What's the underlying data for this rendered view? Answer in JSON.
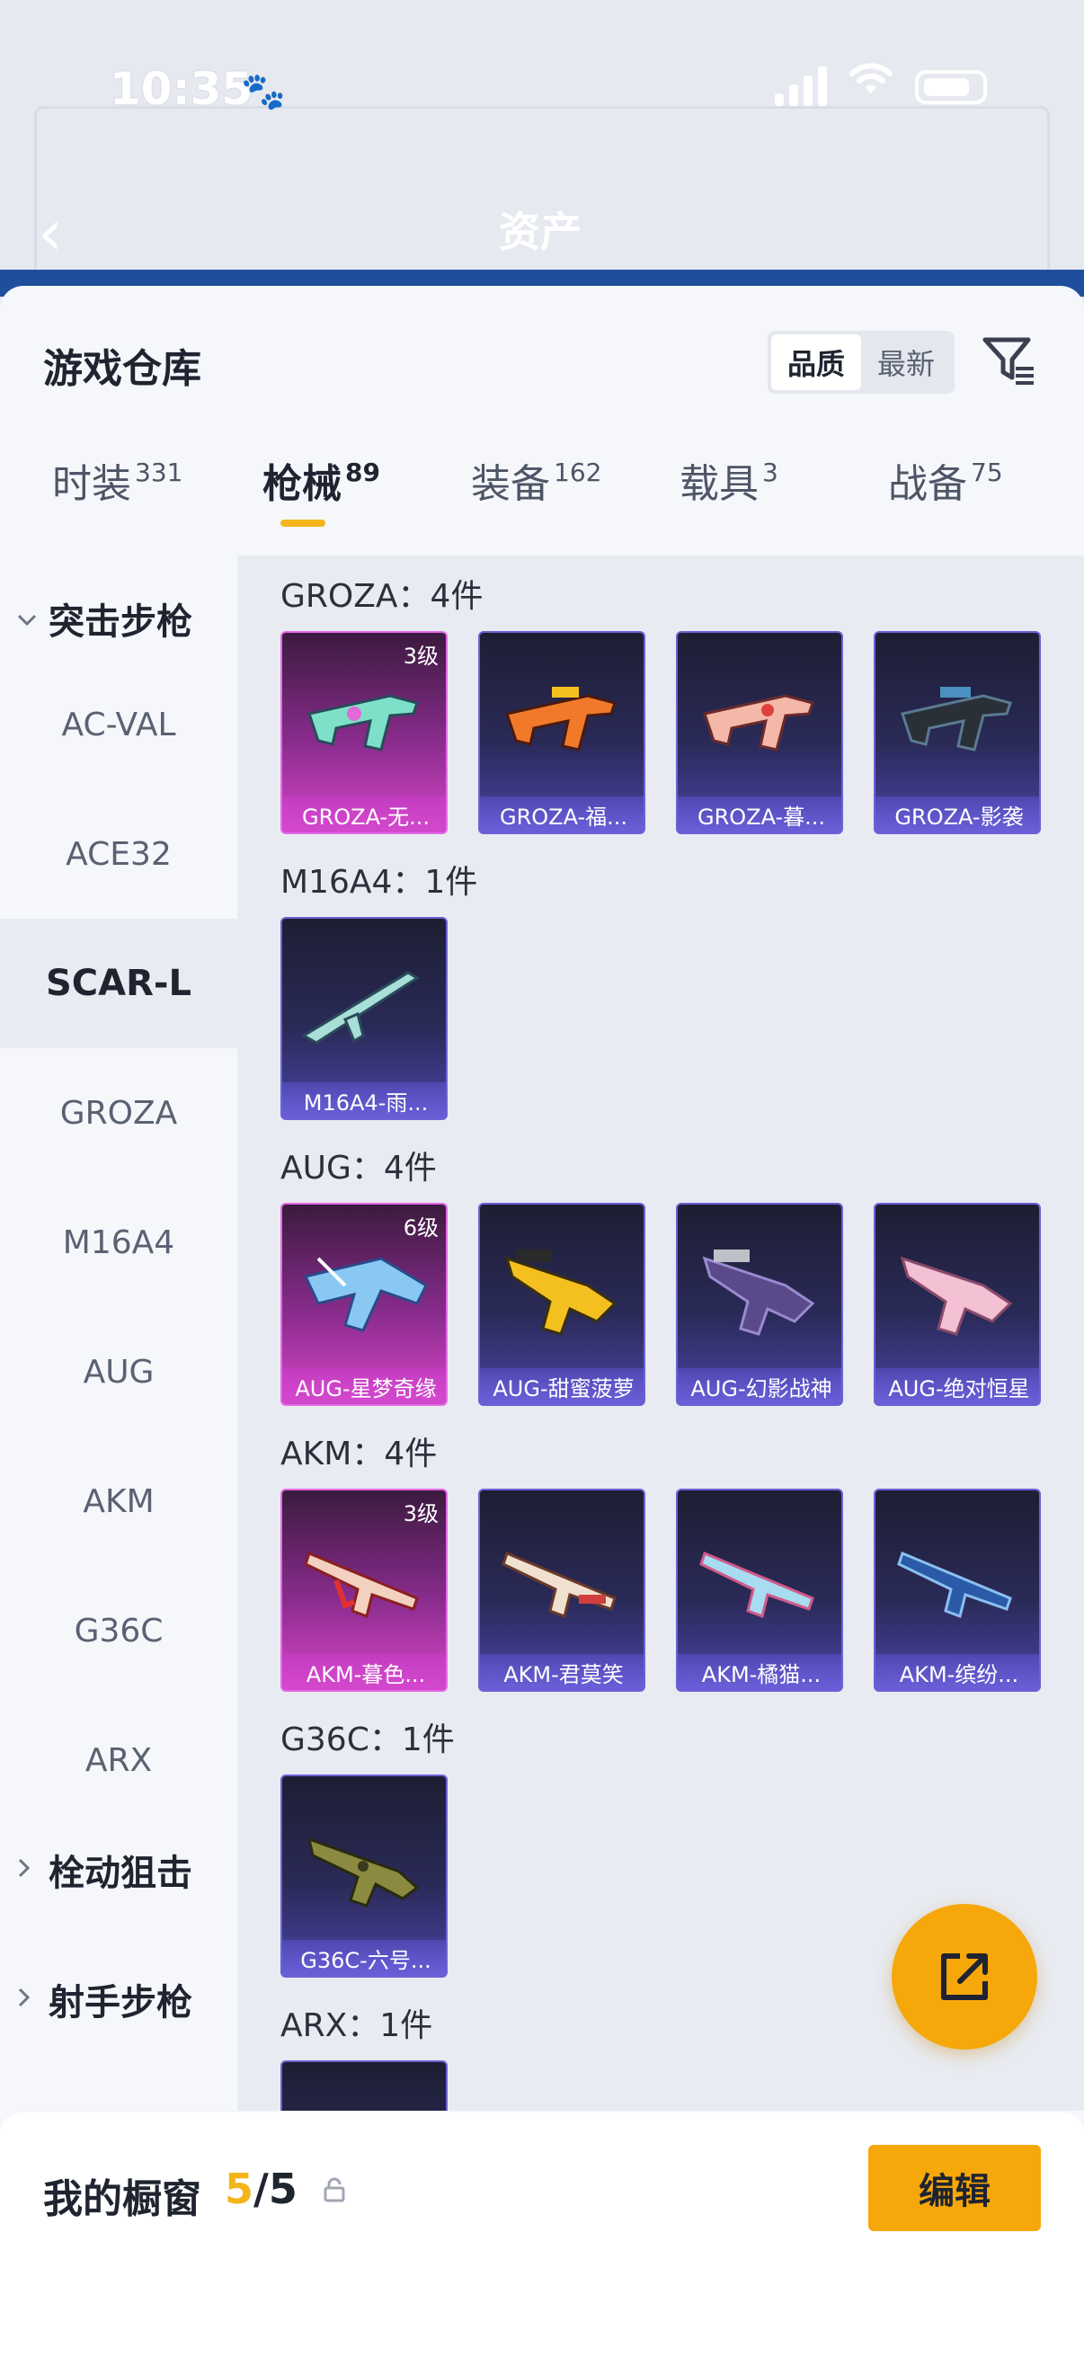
{
  "status": {
    "time": "10:35"
  },
  "header": {
    "title": "资产"
  },
  "sheet": {
    "title": "游戏仓库",
    "sort": {
      "quality": "品质",
      "latest": "最新"
    },
    "tabs": [
      {
        "label": "时装",
        "count": "331"
      },
      {
        "label": "枪械",
        "count": "89"
      },
      {
        "label": "装备",
        "count": "162"
      },
      {
        "label": "载具",
        "count": "3"
      },
      {
        "label": "战备",
        "count": "75"
      }
    ]
  },
  "sidebar": {
    "group1": "突击步枪",
    "items": [
      "AC-VAL",
      "ACE32",
      "SCAR-L",
      "GROZA",
      "M16A4",
      "AUG",
      "AKM",
      "G36C",
      "ARX"
    ],
    "group2": "栓动狙击",
    "group3": "射手步枪"
  },
  "groups": [
    {
      "title": "GROZA：4件",
      "cards": [
        {
          "name": "GROZA-无...",
          "level": "3级"
        },
        {
          "name": "GROZA-福..."
        },
        {
          "name": "GROZA-暮..."
        },
        {
          "name": "GROZA-影袭"
        }
      ]
    },
    {
      "title": "M16A4：1件",
      "cards": [
        {
          "name": "M16A4-雨..."
        }
      ]
    },
    {
      "title": "AUG：4件",
      "cards": [
        {
          "name": "AUG-星梦奇缘",
          "level": "6级"
        },
        {
          "name": "AUG-甜蜜菠萝"
        },
        {
          "name": "AUG-幻影战神"
        },
        {
          "name": "AUG-绝对恒星"
        }
      ]
    },
    {
      "title": "AKM：4件",
      "cards": [
        {
          "name": "AKM-暮色...",
          "level": "3级"
        },
        {
          "name": "AKM-君莫笑"
        },
        {
          "name": "AKM-橘猫..."
        },
        {
          "name": "AKM-缤纷..."
        }
      ]
    },
    {
      "title": "G36C：1件",
      "cards": [
        {
          "name": "G36C-六号..."
        }
      ]
    },
    {
      "title": "ARX：1件"
    }
  ],
  "showcase": {
    "title": "我的橱窗",
    "current": "5",
    "sep_total": "/5",
    "edit": "编辑"
  },
  "colors": {
    "accent": "#f6a80b",
    "pink_rarity": "#d846c8",
    "purple_rarity": "#6a5fd8"
  },
  "icons": [
    "back-arrow-icon",
    "filter-icon",
    "chevron-down-icon",
    "chevron-right-icon",
    "share-icon",
    "lock-icon",
    "paw-icon",
    "wifi-icon",
    "signal-icon",
    "battery-icon"
  ]
}
